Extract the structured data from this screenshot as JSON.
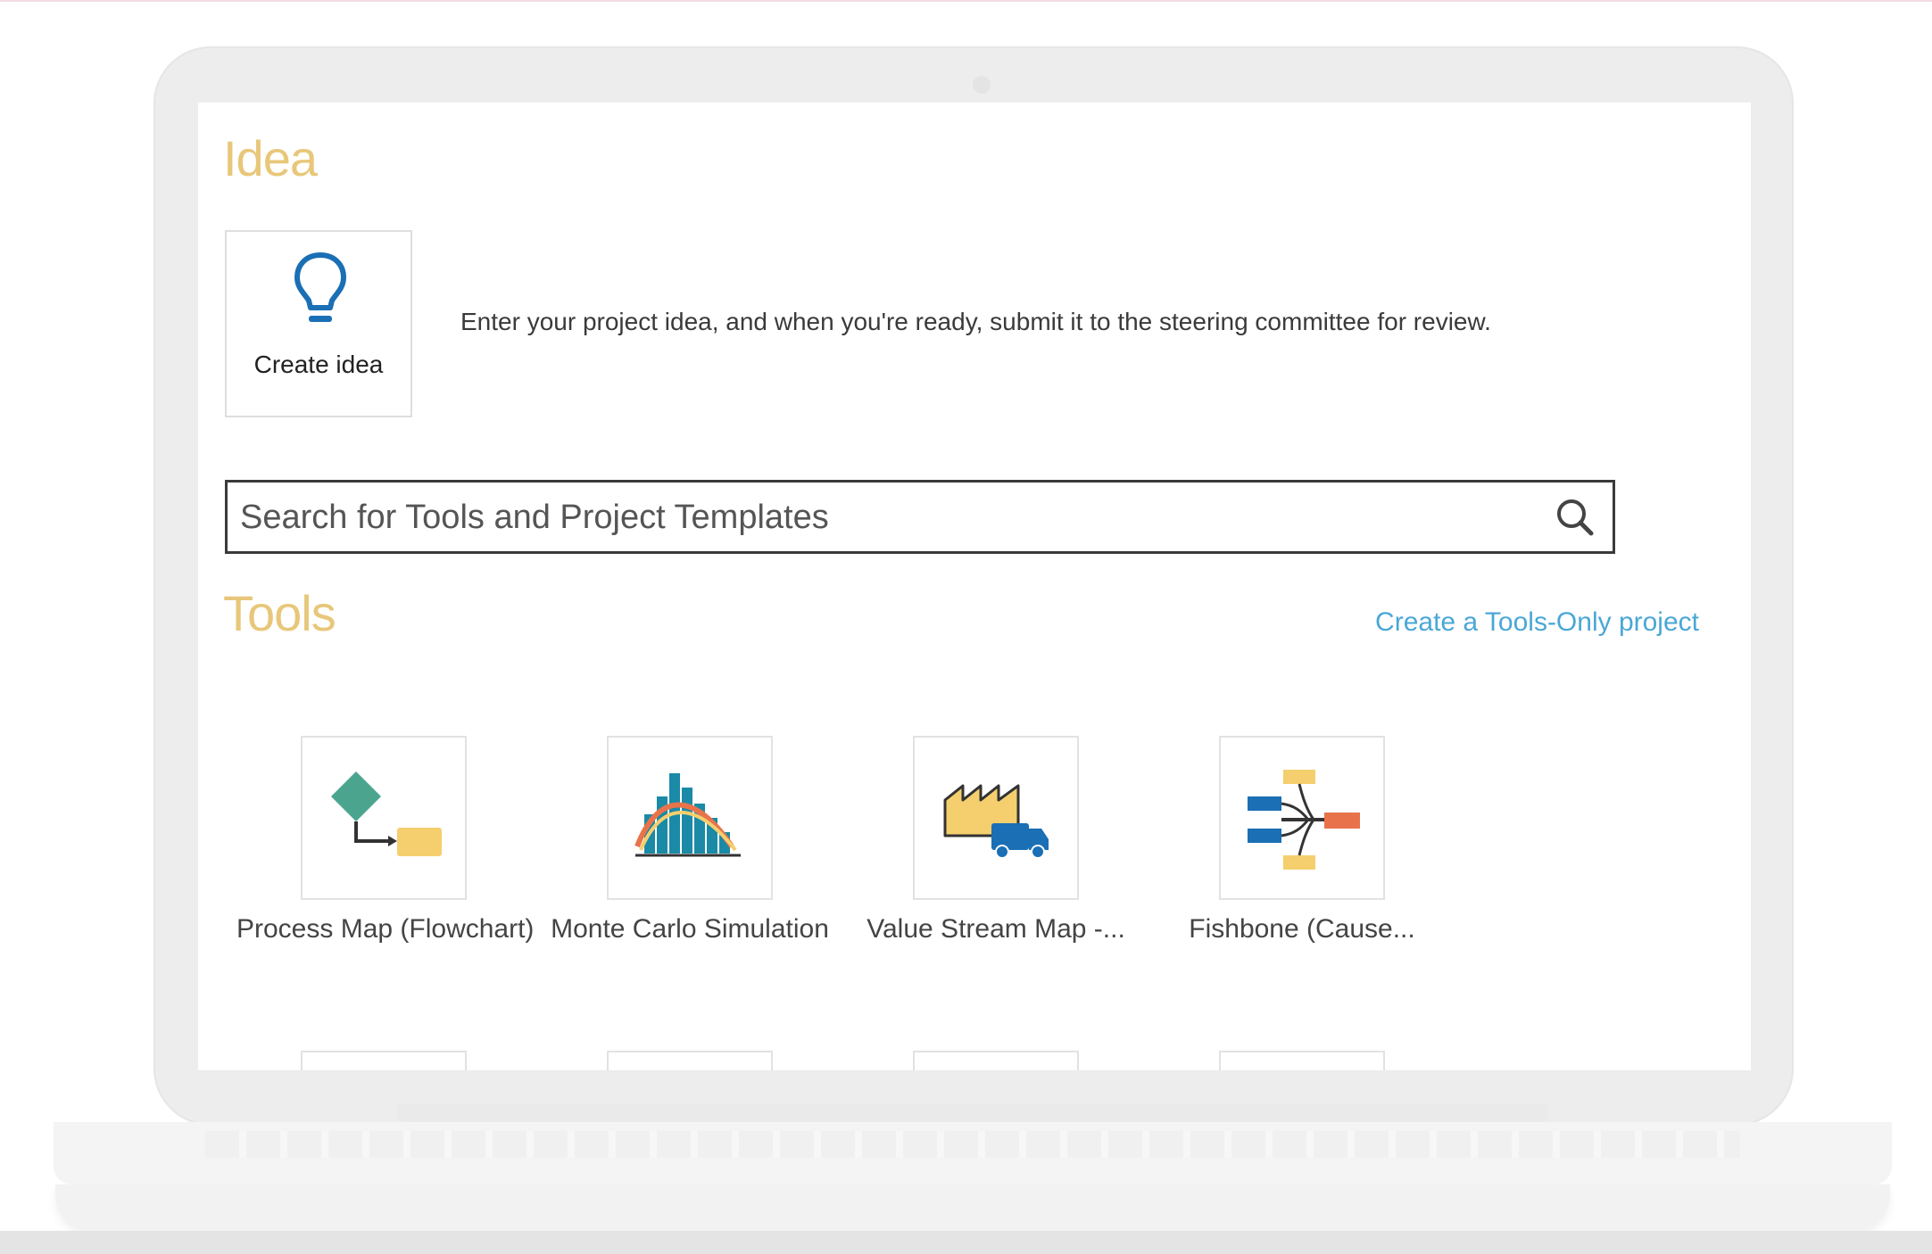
{
  "idea": {
    "title": "Idea",
    "create_label": "Create idea",
    "description": "Enter your project idea, and when you're ready, submit it to the steering committee for review."
  },
  "search": {
    "placeholder": "Search for Tools and Project Templates",
    "icon": "search-icon"
  },
  "tools": {
    "title": "Tools",
    "link": "Create a Tools-Only project",
    "items": [
      {
        "label": "Process Map (Flowchart)",
        "icon": "process-map-icon"
      },
      {
        "label": "Monte Carlo Simulation",
        "icon": "monte-carlo-icon"
      },
      {
        "label": "Value Stream Map -...",
        "icon": "value-stream-map-icon"
      },
      {
        "label": "Fishbone (Cause...",
        "icon": "fishbone-icon"
      }
    ]
  },
  "colors": {
    "section_title": "#e8c77a",
    "link": "#4aa7d6",
    "bulb": "#1a6fb5"
  }
}
